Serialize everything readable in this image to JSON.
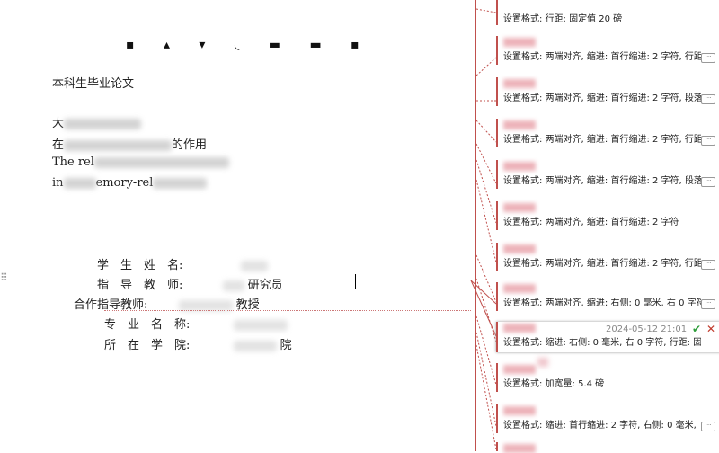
{
  "document": {
    "header": "本科生毕业论文",
    "titles": [
      {
        "prefix": "大",
        "suffix": ""
      },
      {
        "prefix": "在",
        "suffix": "的作用"
      },
      {
        "prefix": "The rel",
        "suffix": ""
      },
      {
        "prefix": "in",
        "suffix": "emory-rel"
      }
    ],
    "fields": [
      {
        "label": "学　生　姓　名:",
        "value": ""
      },
      {
        "label": "指　导　教　师:",
        "value": "研究员"
      },
      {
        "label": "合作指导教师:",
        "value": "教授"
      },
      {
        "label": "专　业　名　称:",
        "value": ""
      },
      {
        "label": "所　在　学　院:",
        "value": "院"
      }
    ]
  },
  "comments": [
    {
      "text": "设置格式: 行距: 固定值 20 磅",
      "more": false
    },
    {
      "text": "设置格式: 两端对齐, 缩进: 首行缩进: 2 字符, 行距",
      "more": true
    },
    {
      "text": "设置格式: 两端对齐, 缩进: 首行缩进: 2 字符, 段落",
      "more": true
    },
    {
      "text": "设置格式: 两端对齐, 缩进: 首行缩进: 2 字符, 行距",
      "more": true
    },
    {
      "text": "设置格式: 两端对齐, 缩进: 首行缩进: 2 字符, 段落",
      "more": true
    },
    {
      "text": "设置格式: 两端对齐, 缩进: 首行缩进: 2 字符",
      "more": false
    },
    {
      "text": "设置格式: 两端对齐, 缩进: 首行缩进: 2 字符, 行距",
      "more": true
    },
    {
      "text": "设置格式: 两端对齐, 缩进: 右侧: 0 毫米, 右 0 字符",
      "more": true
    },
    {
      "text": "设置格式: 缩进: 右侧: 0 毫米, 右 0 字符, 行距: 固",
      "more": false,
      "active": true,
      "date": "2024-05-12 21:01"
    },
    {
      "text": "设置格式: 加宽量: 5.4 磅",
      "more": false
    },
    {
      "text": "设置格式: 缩进: 首行缩进: 2 字符, 右侧: 0 毫米,",
      "more": true
    }
  ]
}
